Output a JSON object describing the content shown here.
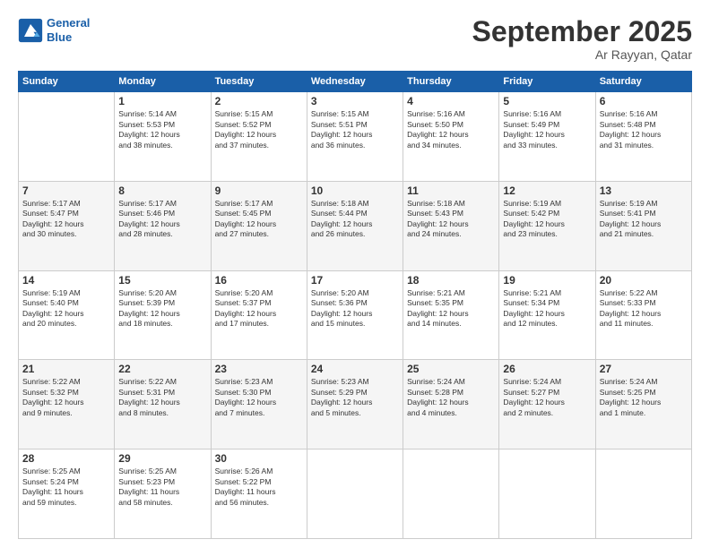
{
  "header": {
    "logo_line1": "General",
    "logo_line2": "Blue",
    "month": "September 2025",
    "location": "Ar Rayyan, Qatar"
  },
  "weekdays": [
    "Sunday",
    "Monday",
    "Tuesday",
    "Wednesday",
    "Thursday",
    "Friday",
    "Saturday"
  ],
  "rows": [
    [
      {
        "day": "",
        "info": ""
      },
      {
        "day": "1",
        "info": "Sunrise: 5:14 AM\nSunset: 5:53 PM\nDaylight: 12 hours\nand 38 minutes."
      },
      {
        "day": "2",
        "info": "Sunrise: 5:15 AM\nSunset: 5:52 PM\nDaylight: 12 hours\nand 37 minutes."
      },
      {
        "day": "3",
        "info": "Sunrise: 5:15 AM\nSunset: 5:51 PM\nDaylight: 12 hours\nand 36 minutes."
      },
      {
        "day": "4",
        "info": "Sunrise: 5:16 AM\nSunset: 5:50 PM\nDaylight: 12 hours\nand 34 minutes."
      },
      {
        "day": "5",
        "info": "Sunrise: 5:16 AM\nSunset: 5:49 PM\nDaylight: 12 hours\nand 33 minutes."
      },
      {
        "day": "6",
        "info": "Sunrise: 5:16 AM\nSunset: 5:48 PM\nDaylight: 12 hours\nand 31 minutes."
      }
    ],
    [
      {
        "day": "7",
        "info": "Sunrise: 5:17 AM\nSunset: 5:47 PM\nDaylight: 12 hours\nand 30 minutes."
      },
      {
        "day": "8",
        "info": "Sunrise: 5:17 AM\nSunset: 5:46 PM\nDaylight: 12 hours\nand 28 minutes."
      },
      {
        "day": "9",
        "info": "Sunrise: 5:17 AM\nSunset: 5:45 PM\nDaylight: 12 hours\nand 27 minutes."
      },
      {
        "day": "10",
        "info": "Sunrise: 5:18 AM\nSunset: 5:44 PM\nDaylight: 12 hours\nand 26 minutes."
      },
      {
        "day": "11",
        "info": "Sunrise: 5:18 AM\nSunset: 5:43 PM\nDaylight: 12 hours\nand 24 minutes."
      },
      {
        "day": "12",
        "info": "Sunrise: 5:19 AM\nSunset: 5:42 PM\nDaylight: 12 hours\nand 23 minutes."
      },
      {
        "day": "13",
        "info": "Sunrise: 5:19 AM\nSunset: 5:41 PM\nDaylight: 12 hours\nand 21 minutes."
      }
    ],
    [
      {
        "day": "14",
        "info": "Sunrise: 5:19 AM\nSunset: 5:40 PM\nDaylight: 12 hours\nand 20 minutes."
      },
      {
        "day": "15",
        "info": "Sunrise: 5:20 AM\nSunset: 5:39 PM\nDaylight: 12 hours\nand 18 minutes."
      },
      {
        "day": "16",
        "info": "Sunrise: 5:20 AM\nSunset: 5:37 PM\nDaylight: 12 hours\nand 17 minutes."
      },
      {
        "day": "17",
        "info": "Sunrise: 5:20 AM\nSunset: 5:36 PM\nDaylight: 12 hours\nand 15 minutes."
      },
      {
        "day": "18",
        "info": "Sunrise: 5:21 AM\nSunset: 5:35 PM\nDaylight: 12 hours\nand 14 minutes."
      },
      {
        "day": "19",
        "info": "Sunrise: 5:21 AM\nSunset: 5:34 PM\nDaylight: 12 hours\nand 12 minutes."
      },
      {
        "day": "20",
        "info": "Sunrise: 5:22 AM\nSunset: 5:33 PM\nDaylight: 12 hours\nand 11 minutes."
      }
    ],
    [
      {
        "day": "21",
        "info": "Sunrise: 5:22 AM\nSunset: 5:32 PM\nDaylight: 12 hours\nand 9 minutes."
      },
      {
        "day": "22",
        "info": "Sunrise: 5:22 AM\nSunset: 5:31 PM\nDaylight: 12 hours\nand 8 minutes."
      },
      {
        "day": "23",
        "info": "Sunrise: 5:23 AM\nSunset: 5:30 PM\nDaylight: 12 hours\nand 7 minutes."
      },
      {
        "day": "24",
        "info": "Sunrise: 5:23 AM\nSunset: 5:29 PM\nDaylight: 12 hours\nand 5 minutes."
      },
      {
        "day": "25",
        "info": "Sunrise: 5:24 AM\nSunset: 5:28 PM\nDaylight: 12 hours\nand 4 minutes."
      },
      {
        "day": "26",
        "info": "Sunrise: 5:24 AM\nSunset: 5:27 PM\nDaylight: 12 hours\nand 2 minutes."
      },
      {
        "day": "27",
        "info": "Sunrise: 5:24 AM\nSunset: 5:25 PM\nDaylight: 12 hours\nand 1 minute."
      }
    ],
    [
      {
        "day": "28",
        "info": "Sunrise: 5:25 AM\nSunset: 5:24 PM\nDaylight: 11 hours\nand 59 minutes."
      },
      {
        "day": "29",
        "info": "Sunrise: 5:25 AM\nSunset: 5:23 PM\nDaylight: 11 hours\nand 58 minutes."
      },
      {
        "day": "30",
        "info": "Sunrise: 5:26 AM\nSunset: 5:22 PM\nDaylight: 11 hours\nand 56 minutes."
      },
      {
        "day": "",
        "info": ""
      },
      {
        "day": "",
        "info": ""
      },
      {
        "day": "",
        "info": ""
      },
      {
        "day": "",
        "info": ""
      }
    ]
  ]
}
